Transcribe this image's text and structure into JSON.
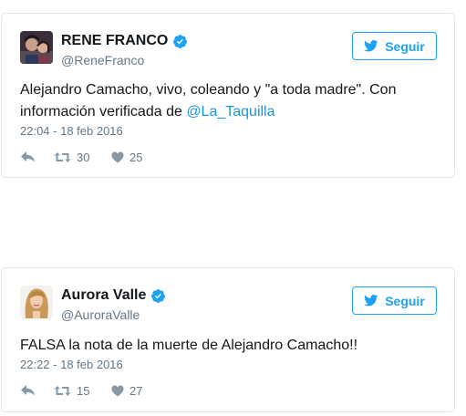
{
  "colors": {
    "link": "#1b95e0",
    "brand": "#1da1f2",
    "border": "#e1e8ed"
  },
  "tweets": [
    {
      "name": "RENE FRANCO",
      "handle": "@ReneFranco",
      "verified_icon": "verified-badge-icon",
      "follow_label": "Seguir",
      "text_before": "Alejandro Camacho, vivo, coleando y \"a toda madre\". Con información verificada de ",
      "mention": "@La_Taquilla",
      "timestamp": "22:04 - 18 feb 2016",
      "retweets": "30",
      "likes": "25"
    },
    {
      "name": "Aurora Valle",
      "handle": "@AuroraValle",
      "verified_icon": "verified-badge-icon",
      "follow_label": "Seguir",
      "text_before": "FALSA la nota de la muerte de Alejandro Camacho!!",
      "mention": "",
      "timestamp": "22:22 - 18 feb 2016",
      "retweets": "15",
      "likes": "27"
    }
  ]
}
